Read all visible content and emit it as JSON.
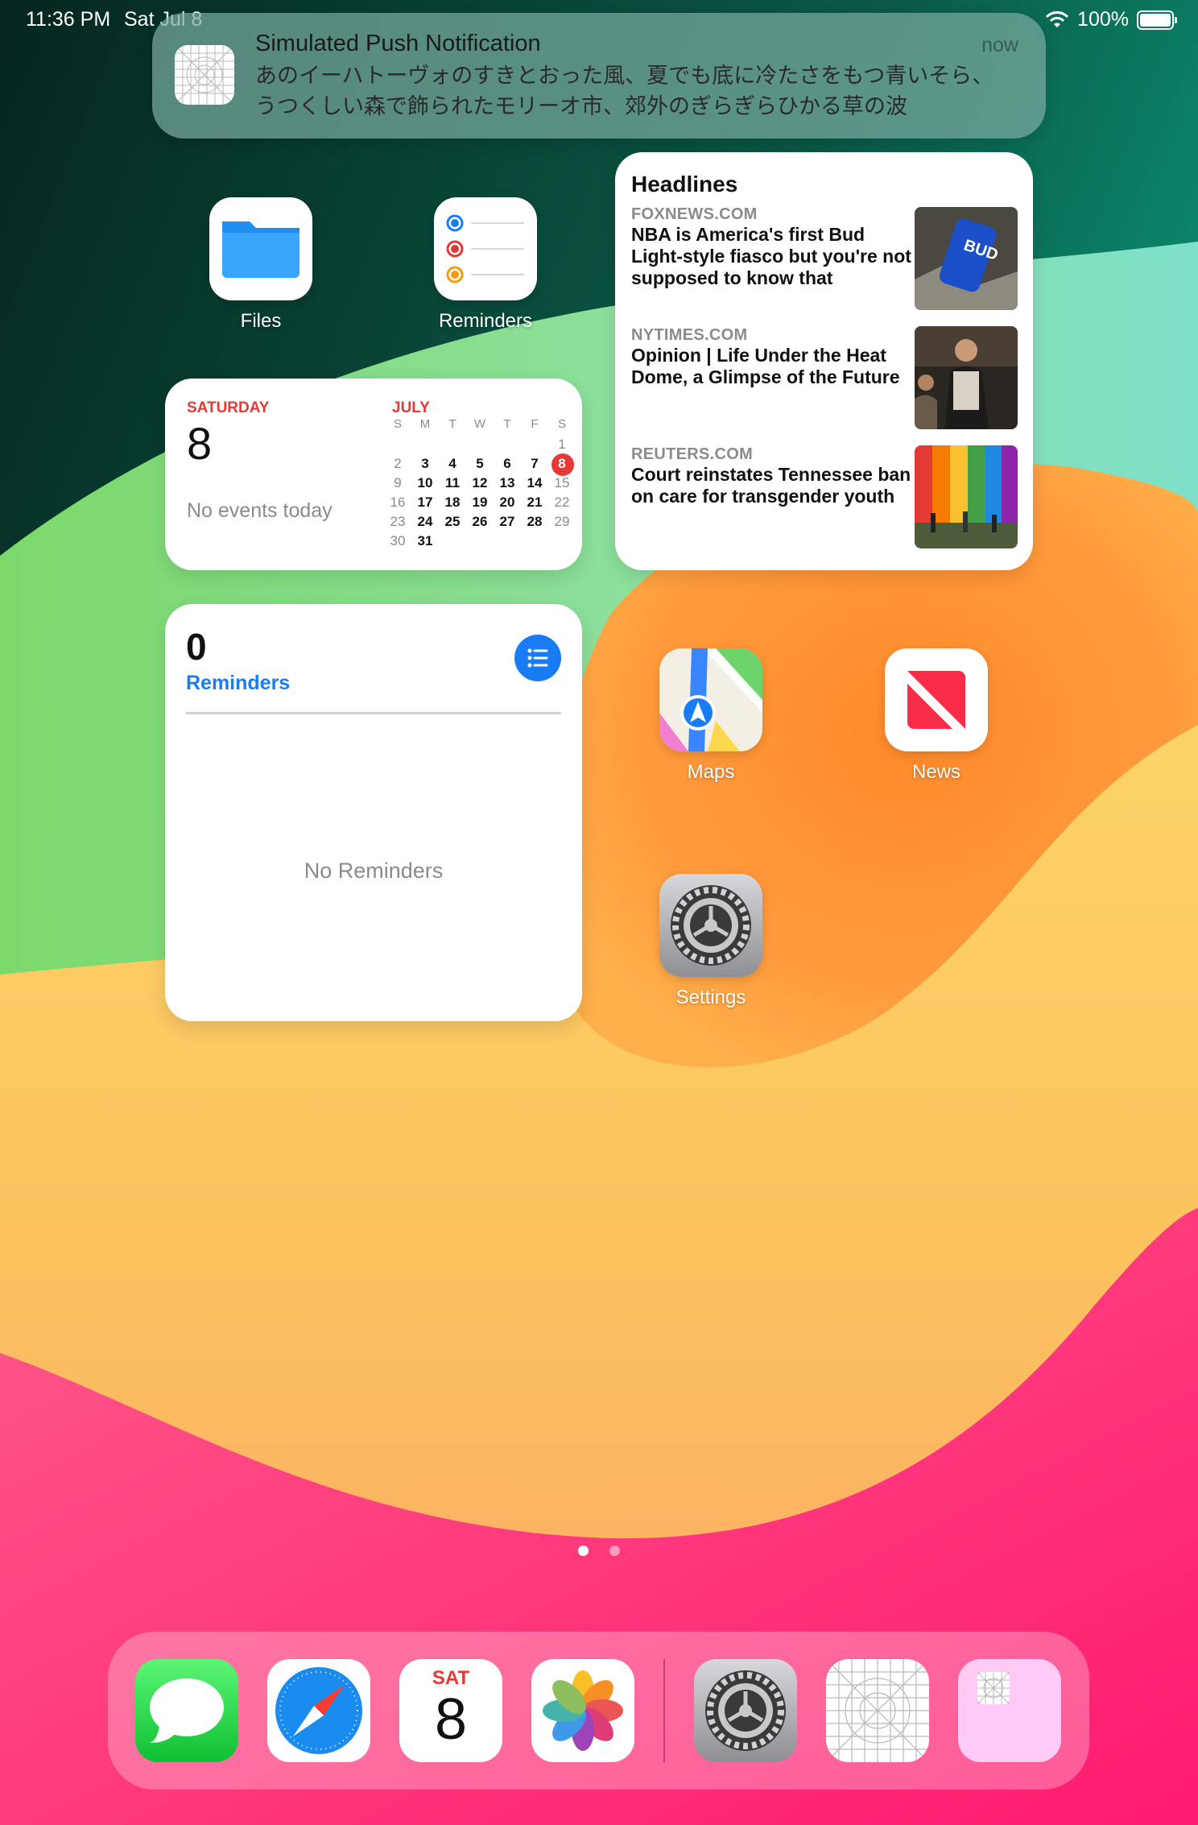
{
  "status_bar": {
    "time": "11:36 PM",
    "date": "Sat Jul 8",
    "battery": "100%"
  },
  "notification": {
    "title": "Simulated Push Notification",
    "time": "now",
    "body": "あのイーハトーヴォのすきとおった風、夏でも底に冷たさをもつ青いそら、うつくしい森で飾られたモリーオ市、郊外のぎらぎらひかる草の波"
  },
  "apps": {
    "files": "Files",
    "reminders": "Reminders",
    "maps": "Maps",
    "news": "News",
    "settings": "Settings"
  },
  "calendar_widget": {
    "weekday": "SATURDAY",
    "day": "8",
    "no_events": "No events today",
    "month": "JULY",
    "weekday_headers": [
      "S",
      "M",
      "T",
      "W",
      "T",
      "F",
      "S"
    ]
  },
  "headlines_widget": {
    "title": "Headlines",
    "items": [
      {
        "source": "FOXNEWS.COM",
        "headline": "NBA is America's first Bud Light-style fiasco but you're not supposed to know that"
      },
      {
        "source": "NYTIMES.COM",
        "headline": "Opinion | Life Under the Heat Dome, a Glimpse of the Future"
      },
      {
        "source": "REUTERS.COM",
        "headline": "Court reinstates Tennessee ban on care for transgender youth"
      }
    ]
  },
  "reminders_widget": {
    "count": "0",
    "label": "Reminders",
    "empty": "No Reminders"
  },
  "dock": {
    "calendar_weekday": "SAT",
    "calendar_day": "8",
    "apps": [
      "messages-icon",
      "safari-icon",
      "calendar-icon",
      "photos-icon",
      "settings-icon",
      "placeholder-app-icon",
      "app-library-icon"
    ]
  },
  "page_indicator": {
    "pages": 2,
    "current": 1
  },
  "colors": {
    "accent_blue": "#1a7cf5",
    "calendar_red": "#e53935"
  }
}
